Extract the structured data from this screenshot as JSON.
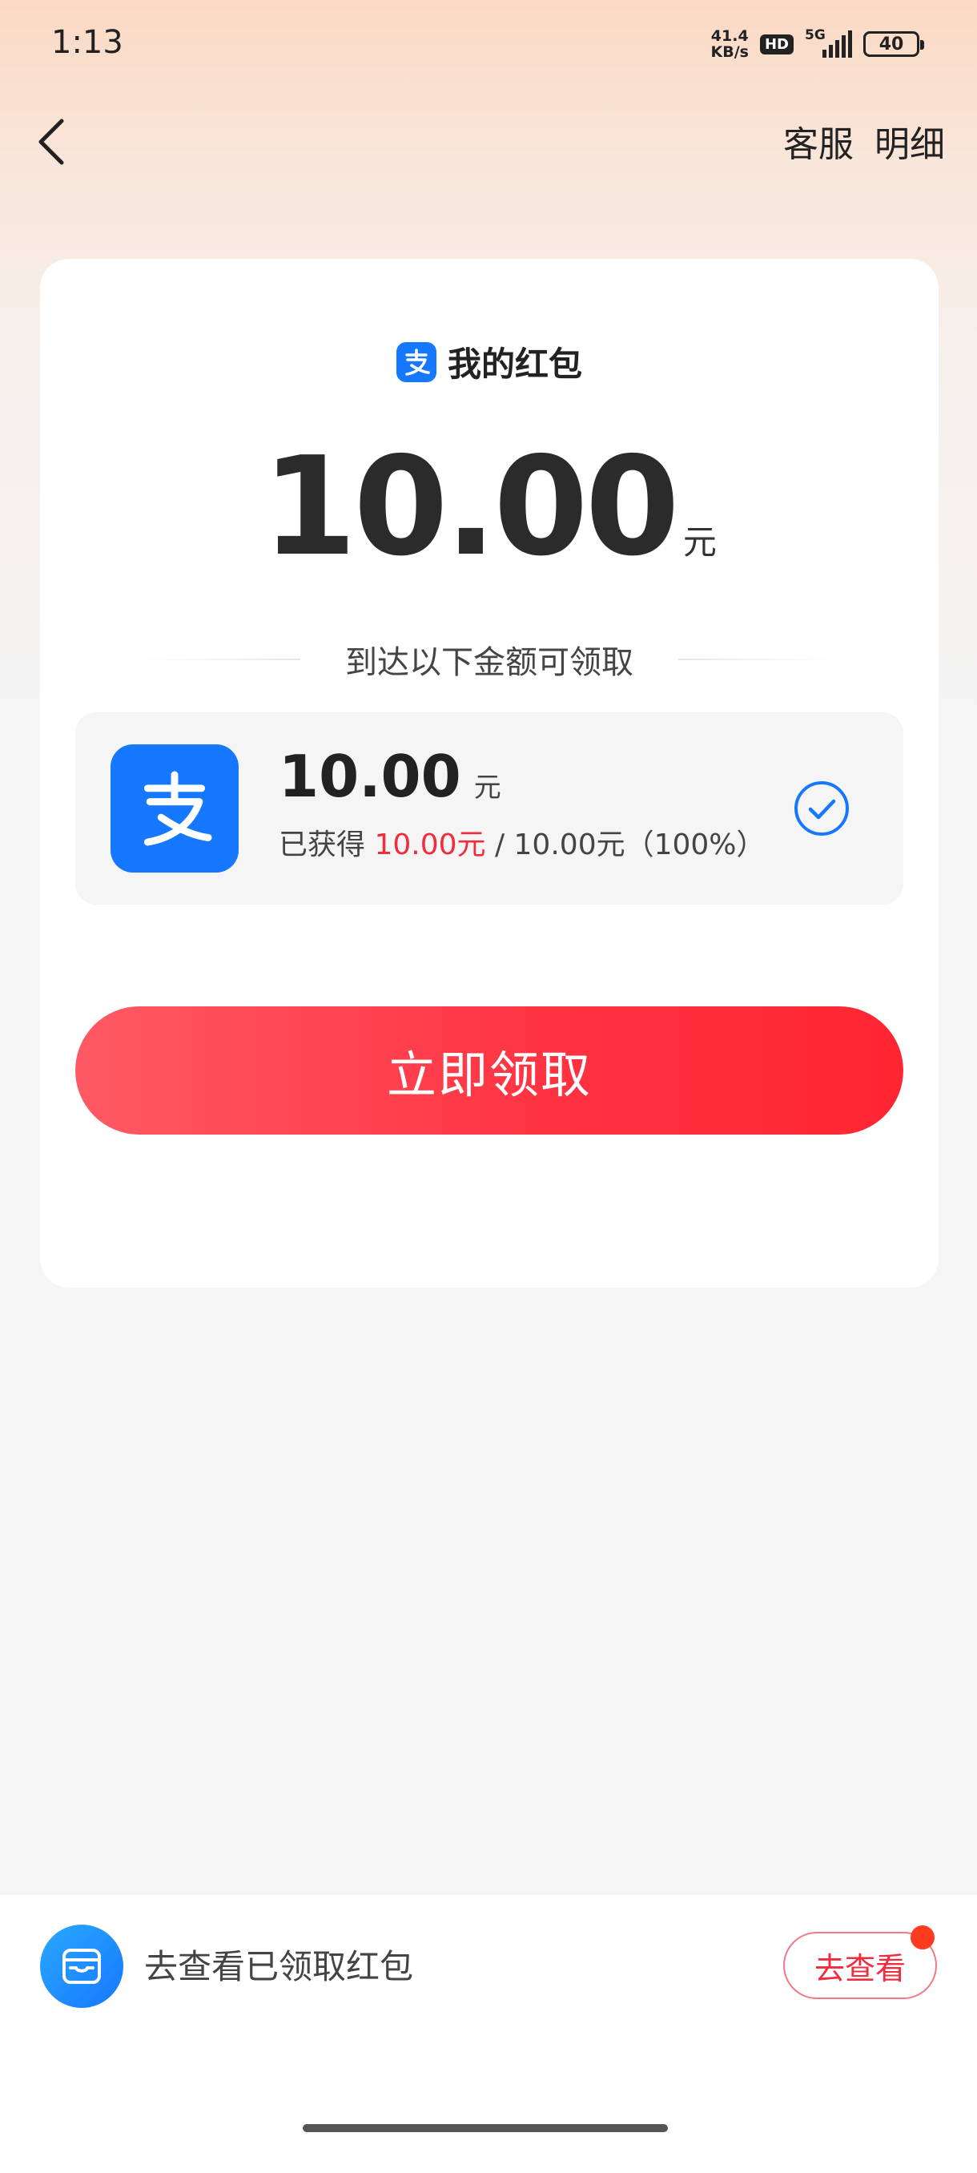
{
  "status_bar": {
    "time": "1:13",
    "net_speed_value": "41.4",
    "net_speed_unit": "KB/s",
    "hd_badge": "HD",
    "network": "5G",
    "battery": "40"
  },
  "nav": {
    "customer_service": "客服",
    "details": "明细"
  },
  "card": {
    "title": "我的红包",
    "amount": "10.00",
    "amount_unit": "元",
    "divider_text": "到达以下金额可领取",
    "reward": {
      "amount": "10.00",
      "unit": "元",
      "progress_prefix": "已获得 ",
      "progress_earned": "10.00元",
      "progress_suffix": " / 10.00元（100%）",
      "progress_percent": 100
    },
    "claim_button": "立即领取"
  },
  "bottom_bar": {
    "text": "去查看已领取红包",
    "view_button": "去查看"
  },
  "colors": {
    "accent_red": "#ff3140",
    "alipay_blue": "#1677ff",
    "highlight_red": "#f22c3d"
  }
}
